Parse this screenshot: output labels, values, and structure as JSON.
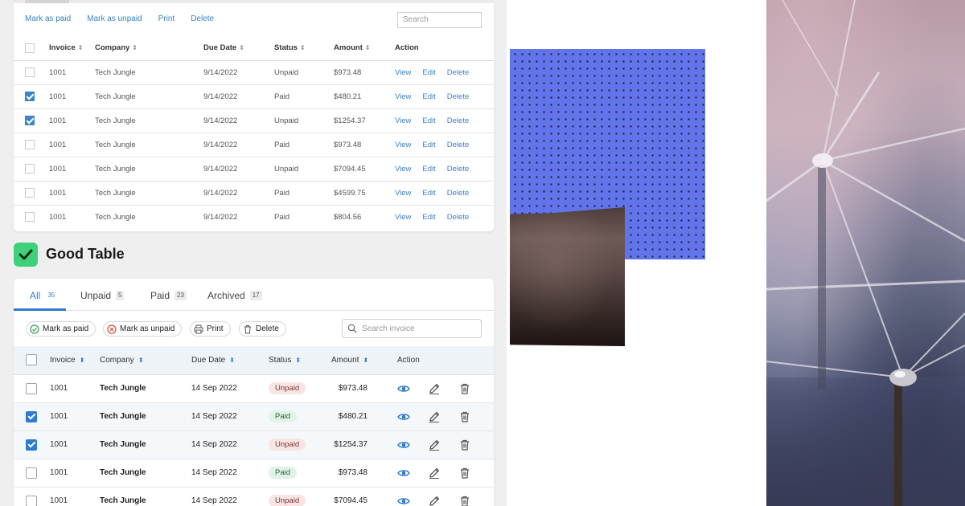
{
  "bad_table": {
    "toolbar": [
      "Mark as paid",
      "Mark as unpaid",
      "Print",
      "Delete"
    ],
    "search_placeholder": "Search",
    "headers": {
      "invoice": "Invoice",
      "company": "Company",
      "due_date": "Due Date",
      "status": "Status",
      "amount": "Amount",
      "action": "Action"
    },
    "sort_glyph": "⇕",
    "actions": {
      "view": "View",
      "edit": "Edit",
      "delete": "Delete"
    },
    "rows": [
      {
        "checked": false,
        "invoice": "1001",
        "company": "Tech Jungle",
        "due": "9/14/2022",
        "status": "Unpaid",
        "amount": "$973.48"
      },
      {
        "checked": true,
        "invoice": "1001",
        "company": "Tech Jungle",
        "due": "9/14/2022",
        "status": "Paid",
        "amount": "$480.21"
      },
      {
        "checked": true,
        "invoice": "1001",
        "company": "Tech Jungle",
        "due": "9/14/2022",
        "status": "Unpaid",
        "amount": "$1254.37"
      },
      {
        "checked": false,
        "invoice": "1001",
        "company": "Tech Jungle",
        "due": "9/14/2022",
        "status": "Paid",
        "amount": "$973.48"
      },
      {
        "checked": false,
        "invoice": "1001",
        "company": "Tech Jungle",
        "due": "9/14/2022",
        "status": "Unpaid",
        "amount": "$7094.45"
      },
      {
        "checked": false,
        "invoice": "1001",
        "company": "Tech Jungle",
        "due": "9/14/2022",
        "status": "Paid",
        "amount": "$4599.75"
      },
      {
        "checked": false,
        "invoice": "1001",
        "company": "Tech Jungle",
        "due": "9/14/2022",
        "status": "Paid",
        "amount": "$804.56"
      }
    ]
  },
  "good_heading": {
    "title": "Good Table",
    "badge_color": "#3fd07a"
  },
  "good_table": {
    "tabs": [
      {
        "label": "All",
        "count": "35",
        "active": true
      },
      {
        "label": "Unpaid",
        "count": "5",
        "active": false
      },
      {
        "label": "Paid",
        "count": "23",
        "active": false
      },
      {
        "label": "Archived",
        "count": "17",
        "active": false
      }
    ],
    "toolbar": {
      "mark_paid": "Mark as paid",
      "mark_unpaid": "Mark as unpaid",
      "print": "Print",
      "delete": "Delete"
    },
    "search_placeholder": "Search invoice",
    "headers": {
      "invoice": "Invoice",
      "company": "Company",
      "due_date": "Due Date",
      "status": "Status",
      "amount": "Amount",
      "action": "Action"
    },
    "sort_glyph": "⬍",
    "rows": [
      {
        "checked": false,
        "invoice": "1001",
        "company": "Tech Jungle",
        "due": "14 Sep 2022",
        "status": "Unpaid",
        "amount": "$973.48"
      },
      {
        "checked": true,
        "invoice": "1001",
        "company": "Tech Jungle",
        "due": "14 Sep 2022",
        "status": "Paid",
        "amount": "$480.21"
      },
      {
        "checked": true,
        "invoice": "1001",
        "company": "Tech Jungle",
        "due": "14 Sep 2022",
        "status": "Unpaid",
        "amount": "$1254.37"
      },
      {
        "checked": false,
        "invoice": "1001",
        "company": "Tech Jungle",
        "due": "14 Sep 2022",
        "status": "Paid",
        "amount": "$973.48"
      },
      {
        "checked": false,
        "invoice": "1001",
        "company": "Tech Jungle",
        "due": "14 Sep 2022",
        "status": "Unpaid",
        "amount": "$7094.45"
      }
    ]
  },
  "colors": {
    "link_blue": "#3b82c4",
    "accent_blue": "#2e7bcf",
    "dot_panel": "#6174ea",
    "unpaid_pill": "#f8e4e2",
    "paid_pill": "#dff3e6"
  },
  "icons": {
    "check_badge": "check-icon",
    "mark_paid": "check-circle-icon",
    "mark_unpaid": "x-circle-icon",
    "print": "printer-icon",
    "delete": "trash-icon",
    "search": "search-icon",
    "view": "eye-icon",
    "edit": "pencil-icon",
    "trash": "trash-icon"
  }
}
